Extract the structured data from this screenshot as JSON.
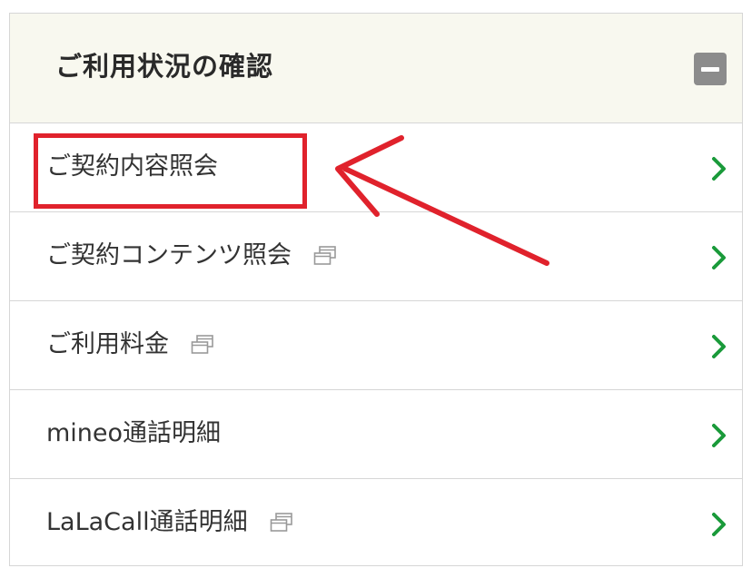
{
  "panel": {
    "title": "ご利用状況の確認",
    "collapse_icon": "minus-icon"
  },
  "menu": {
    "items": [
      {
        "label": "ご契約内容照会",
        "external": false
      },
      {
        "label": "ご契約コンテンツ照会",
        "external": true
      },
      {
        "label": "ご利用料金",
        "external": true
      },
      {
        "label": "mineo通話明細",
        "external": false
      },
      {
        "label": "LaLaCall通話明細",
        "external": true
      }
    ]
  },
  "icons": {
    "chevron": "chevron-right-icon",
    "external": "new-window-icon"
  },
  "colors": {
    "header_bg": "#f8f8ef",
    "chevron": "#1a9a3a",
    "annotation": "#e0222c",
    "collapse_bg": "#8c8c8c"
  }
}
